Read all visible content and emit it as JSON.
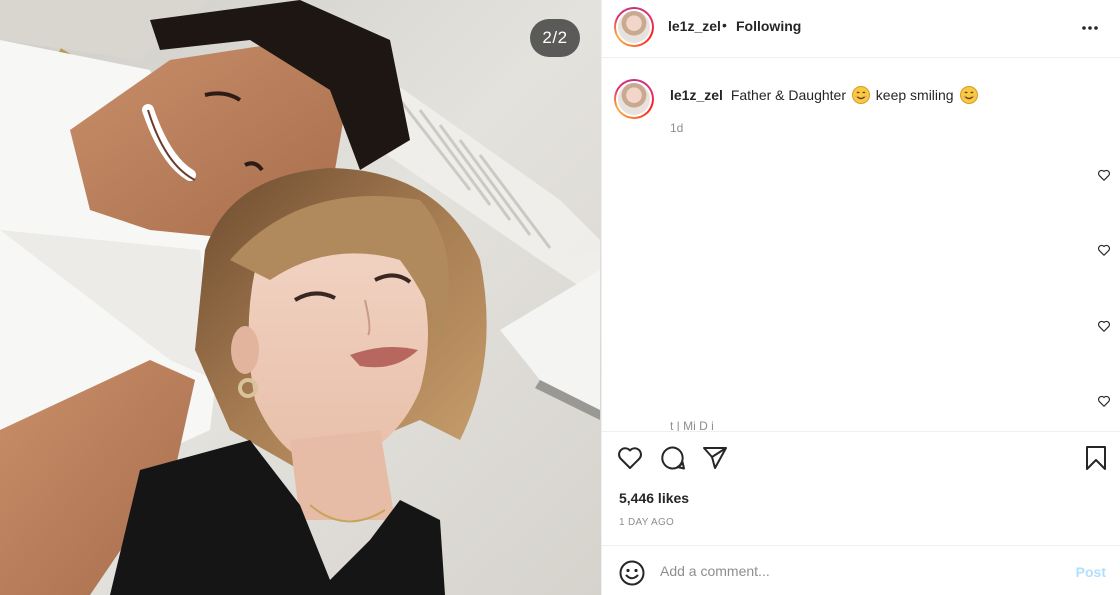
{
  "post": {
    "username": "le1z_zel",
    "separator": "•",
    "follow_status": "Following",
    "image_counter": "2/2"
  },
  "caption": {
    "username": "le1z_zel",
    "text_part1": "Father & Daughter",
    "text_part2": "keep smiling",
    "emoji": "smiling-face-emoji",
    "time": "1d"
  },
  "comments": {
    "partial_text": "t  | Mi  D  i"
  },
  "actions": {
    "icons": [
      "heart-icon",
      "comment-icon",
      "share-icon",
      "bookmark-icon"
    ],
    "likes": "5,446 likes",
    "time_ago": "1 DAY AGO"
  },
  "comment_box": {
    "placeholder": "Add a comment...",
    "post_label": "Post"
  },
  "colors": {
    "text": "#262626",
    "muted": "#8e8e8e",
    "post_disabled": "#b2dffc",
    "border": "#efefef"
  }
}
